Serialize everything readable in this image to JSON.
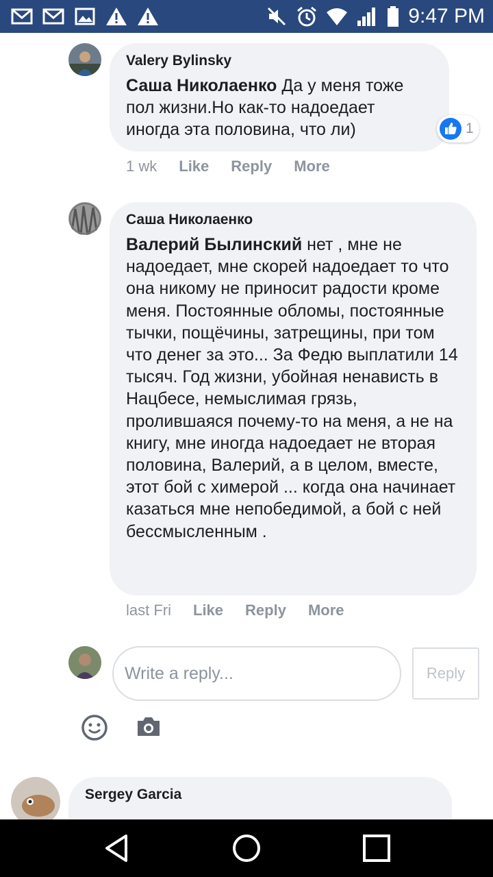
{
  "status_bar": {
    "time": "9:47 PM",
    "left_icons": [
      "gmail-icon",
      "gmail-icon",
      "image-icon",
      "warning-icon",
      "warning-icon"
    ],
    "right_icons": [
      "mute-icon",
      "alarm-icon",
      "wifi-icon",
      "signal-icon",
      "battery-icon"
    ]
  },
  "comments": [
    {
      "author": "Valery Bylinsky",
      "mention": "Саша Николаенко",
      "text": " Да у меня тоже пол жизни.Но как-то надоедает иногда эта половина, что ли)",
      "time": "1 wk",
      "reaction": {
        "type": "like",
        "count": "1"
      },
      "actions": {
        "like": "Like",
        "reply": "Reply",
        "more": "More"
      }
    },
    {
      "author": "Саша Николаенко",
      "mention": "Валерий Былинский",
      "text": " нет , мне не надоедает, мне скорей надоедает то что она никому не приносит радости кроме меня. Постоянные обломы, постоянные тычки, пощёчины, затрещины, при том что денег за это... За Федю выплатили 14 тысяч. Год жизни, убойная ненависть в Нацбесе, немыслимая грязь, пролившаяся почему-то на меня, а не на книгу, мне иногда надоедает не вторая половина, Валерий, а в целом, вместе, этот бой с химерой ... когда она начинает казаться мне непобедимой, а бой с ней бессмысленным .",
      "time": "last Fri",
      "actions": {
        "like": "Like",
        "reply": "Reply",
        "more": "More"
      }
    }
  ],
  "reply_box": {
    "placeholder": "Write a reply...",
    "button": "Reply",
    "icons": [
      "smiley-icon",
      "camera-icon"
    ]
  },
  "next_comment": {
    "author": "Sergey Garcia"
  },
  "nav_bar": [
    "back-icon",
    "home-icon",
    "recents-icon"
  ]
}
